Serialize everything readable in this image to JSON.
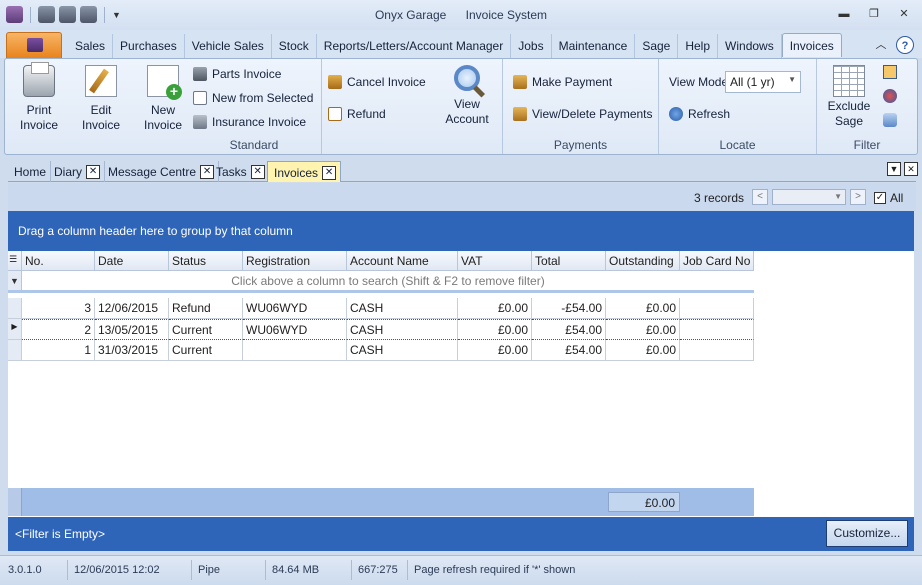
{
  "window": {
    "app_name": "Onyx Garage",
    "module_name": "Invoice System"
  },
  "menu": {
    "tabs": [
      "Sales",
      "Purchases",
      "Vehicle Sales",
      "Stock",
      "Reports/Letters/Account Manager",
      "Jobs",
      "Maintenance",
      "Sage",
      "Help",
      "Windows",
      "Invoices"
    ],
    "active_tab": "Invoices"
  },
  "ribbon": {
    "standard": {
      "label": "Standard",
      "print_invoice": [
        "Print",
        "Invoice"
      ],
      "edit_invoice": [
        "Edit",
        "Invoice"
      ],
      "new_invoice": [
        "New",
        "Invoice"
      ],
      "parts_invoice": "Parts Invoice",
      "new_from_selected": "New from Selected",
      "insurance_invoice": "Insurance Invoice",
      "cancel_invoice": "Cancel Invoice",
      "refund": "Refund",
      "view_account": [
        "View",
        "Account"
      ]
    },
    "payments": {
      "label": "Payments",
      "make_payment": "Make Payment",
      "view_delete_payments": "View/Delete Payments"
    },
    "locate": {
      "label": "Locate",
      "view_mode_label": "View Mode",
      "view_mode_value": "All (1 yr)",
      "refresh": "Refresh"
    },
    "filter": {
      "label": "Filter",
      "exclude_sage": [
        "Exclude",
        "Sage"
      ]
    }
  },
  "doc_tabs": [
    "Home",
    "Diary",
    "Message Centre",
    "Tasks",
    "Invoices"
  ],
  "active_doc_tab": "Invoices",
  "records": {
    "count_text": "3 records",
    "all_label": "All",
    "all_checked": true
  },
  "grid": {
    "group_hint": "Drag a column header here to group by that column",
    "filter_hint": "Click above a column to search (Shift & F2 to remove filter)",
    "columns": [
      "No.",
      "Date",
      "Status",
      "Registration",
      "Account Name",
      "VAT",
      "Total",
      "Outstanding",
      "Job Card No"
    ],
    "rows": [
      [
        "3",
        "12/06/2015",
        "Refund",
        "WU06WYD",
        "CASH",
        "£0.00",
        "-£54.00",
        "£0.00",
        ""
      ],
      [
        "2",
        "13/05/2015",
        "Current",
        "WU06WYD",
        "CASH",
        "£0.00",
        "£54.00",
        "£0.00",
        ""
      ],
      [
        "1",
        "31/03/2015",
        "Current",
        "",
        "CASH",
        "£0.00",
        "£54.00",
        "£0.00",
        ""
      ]
    ],
    "focused_row": 1,
    "outstanding_total": "£0.00"
  },
  "filter_bar": {
    "text": "<Filter is Empty>",
    "customize_label": "Customize..."
  },
  "status_bar": {
    "version": "3.0.1.0",
    "datetime": "12/06/2015 12:02",
    "pipe": "Pipe",
    "memory": "84.64 MB",
    "position": "667:275",
    "message": "Page refresh required if '*' shown"
  }
}
